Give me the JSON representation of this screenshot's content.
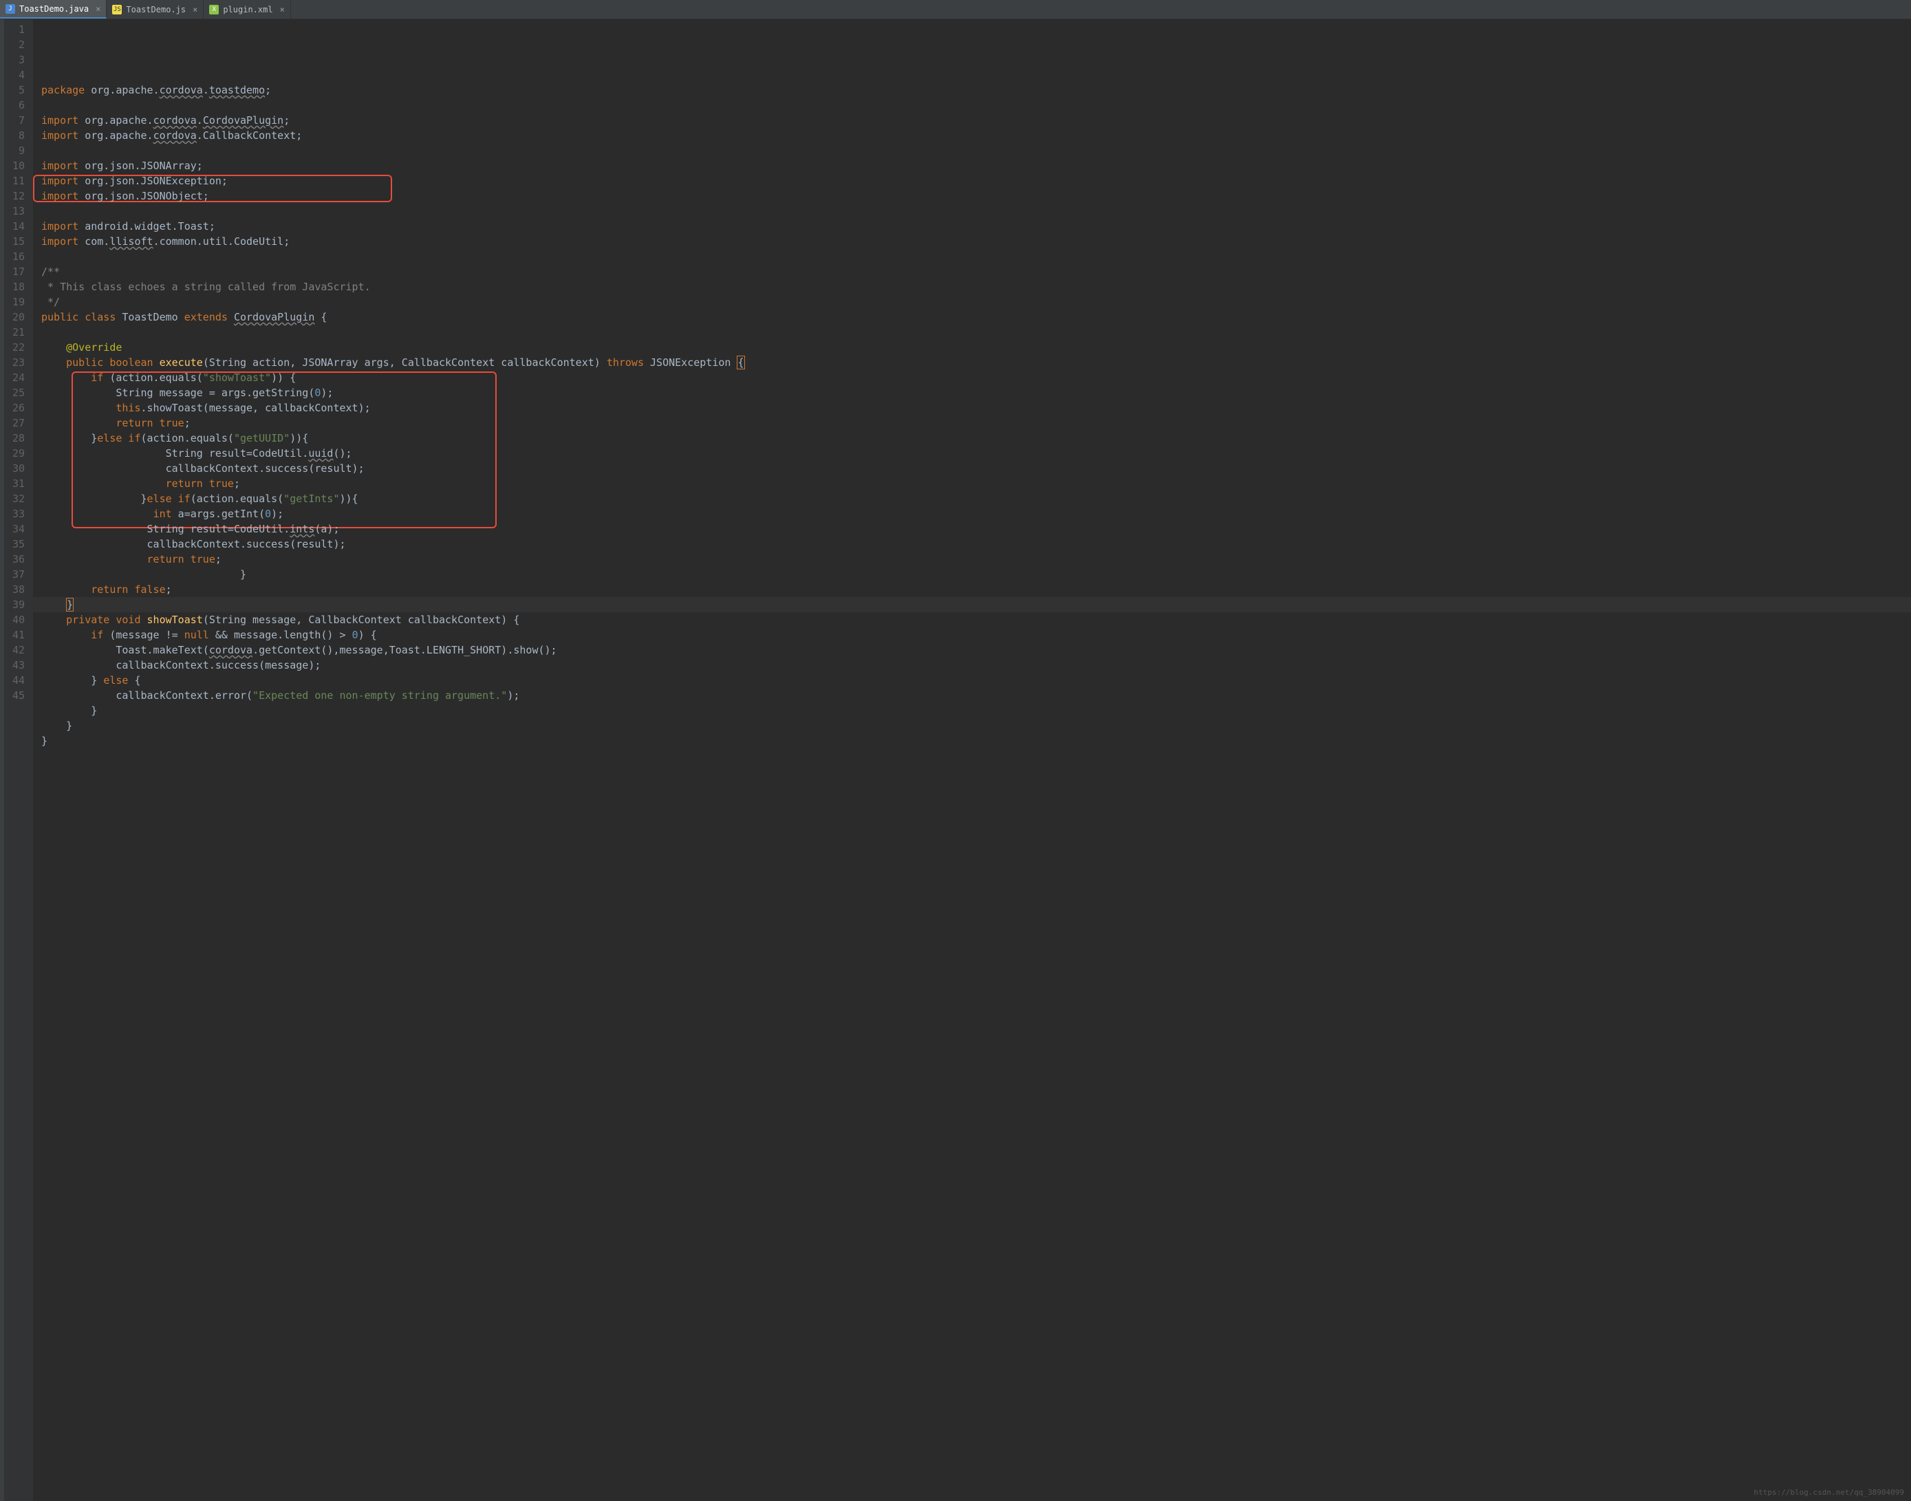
{
  "tabs": [
    {
      "label": "ToastDemo.java",
      "active": true,
      "icon": "J"
    },
    {
      "label": "ToastDemo.js",
      "active": false,
      "icon": "JS"
    },
    {
      "label": "plugin.xml",
      "active": false,
      "icon": "X"
    }
  ],
  "line_count": 45,
  "current_line": 35,
  "code_lines": [
    {
      "n": 1,
      "html": "<span class='kw'>package</span> org.apache.<span class='underline-wave'>cordova</span>.<span class='underline-wave'>toastdemo</span>;"
    },
    {
      "n": 2,
      "html": ""
    },
    {
      "n": 3,
      "html": "<span class='kw'>import</span> org.apache.<span class='underline-wave'>cordova</span>.<span class='underline-wave'>CordovaPlugin</span>;"
    },
    {
      "n": 4,
      "html": "<span class='kw'>import</span> org.apache.<span class='underline-wave'>cordova</span>.CallbackContext;"
    },
    {
      "n": 5,
      "html": ""
    },
    {
      "n": 6,
      "html": "<span class='kw'>import</span> org.json.JSONArray;"
    },
    {
      "n": 7,
      "html": "<span class='kw'>import</span> org.json.JSONException;"
    },
    {
      "n": 8,
      "html": "<span class='kw'>import</span> org.json.JSONObject;"
    },
    {
      "n": 9,
      "html": ""
    },
    {
      "n": 10,
      "html": "<span class='kw'>import</span> android.widget.Toast;"
    },
    {
      "n": 11,
      "html": "<span class='kw'>import</span> com.<span class='underline-wave'>llisoft</span>.common.util.CodeUtil;"
    },
    {
      "n": 12,
      "html": ""
    },
    {
      "n": 13,
      "html": "<span class='comment'>/**</span>"
    },
    {
      "n": 14,
      "html": "<span class='comment'> * This class echoes a string called from JavaScript.</span>"
    },
    {
      "n": 15,
      "html": "<span class='comment'> */</span>"
    },
    {
      "n": 16,
      "html": "<span class='kw'>public class</span> ToastDemo <span class='kw'>extends</span> <span class='underline-wave'>CordovaPlugin</span> {"
    },
    {
      "n": 17,
      "html": ""
    },
    {
      "n": 18,
      "html": "    <span class='annotation'>@Override</span>"
    },
    {
      "n": 19,
      "html": "    <span class='kw'>public boolean</span> <span class='method'>execute</span>(String action, JSONArray args, CallbackContext callbackContext) <span class='kw'>throws</span> JSONException <span class='brace-hl'>{</span>"
    },
    {
      "n": 20,
      "html": "        <span class='kw'>if</span> (action.equals(<span class='str'>\"showToast\"</span>)) {"
    },
    {
      "n": 21,
      "html": "            String message = args.getString(<span class='num'>0</span>);"
    },
    {
      "n": 22,
      "html": "            <span class='kw'>this</span>.showToast(message, callbackContext);"
    },
    {
      "n": 23,
      "html": "            <span class='kw'>return true</span>;"
    },
    {
      "n": 24,
      "html": "        }<span class='kw'>else if</span>(action.equals(<span class='str'>\"getUUID\"</span>)){"
    },
    {
      "n": 25,
      "html": "                    String result=CodeUtil.<span class='underline-wave'>uuid</span>();"
    },
    {
      "n": 26,
      "html": "                    callbackContext.success(result);"
    },
    {
      "n": 27,
      "html": "                    <span class='kw'>return true</span>;"
    },
    {
      "n": 28,
      "html": "                }<span class='kw'>else if</span>(action.equals(<span class='str'>\"getInts\"</span>)){"
    },
    {
      "n": 29,
      "html": "                  <span class='kw'>int</span> a=args.getInt(<span class='num'>0</span>);"
    },
    {
      "n": 30,
      "html": "                 String result=CodeUtil.<span class='underline-wave'>ints</span>(a);"
    },
    {
      "n": 31,
      "html": "                 callbackContext.success(result);"
    },
    {
      "n": 32,
      "html": "                 <span class='kw'>return true</span>;"
    },
    {
      "n": 33,
      "html": "                                }"
    },
    {
      "n": 34,
      "html": "        <span class='kw'>return false</span>;"
    },
    {
      "n": 35,
      "html": "    <span class='brace-hl'>}</span>"
    },
    {
      "n": 36,
      "html": "    <span class='kw'>private void</span> <span class='method'>showToast</span>(String message, CallbackContext callbackContext) {"
    },
    {
      "n": 37,
      "html": "        <span class='kw'>if</span> (message != <span class='kw'>null</span> && message.length() > <span class='num'>0</span>) {"
    },
    {
      "n": 38,
      "html": "            Toast.makeText(<span class='underline-wave'>cordova</span>.getContext(),message,Toast.LENGTH_SHORT).show();"
    },
    {
      "n": 39,
      "html": "            callbackContext.success(message);"
    },
    {
      "n": 40,
      "html": "        } <span class='kw'>else</span> {"
    },
    {
      "n": 41,
      "html": "            callbackContext.error(<span class='str'>\"Expected one non-empty string argument.\"</span>);"
    },
    {
      "n": 42,
      "html": "        }"
    },
    {
      "n": 43,
      "html": "    }"
    },
    {
      "n": 44,
      "html": "}"
    },
    {
      "n": 45,
      "html": ""
    }
  ],
  "watermark": "https://blog.csdn.net/qq_38904099"
}
